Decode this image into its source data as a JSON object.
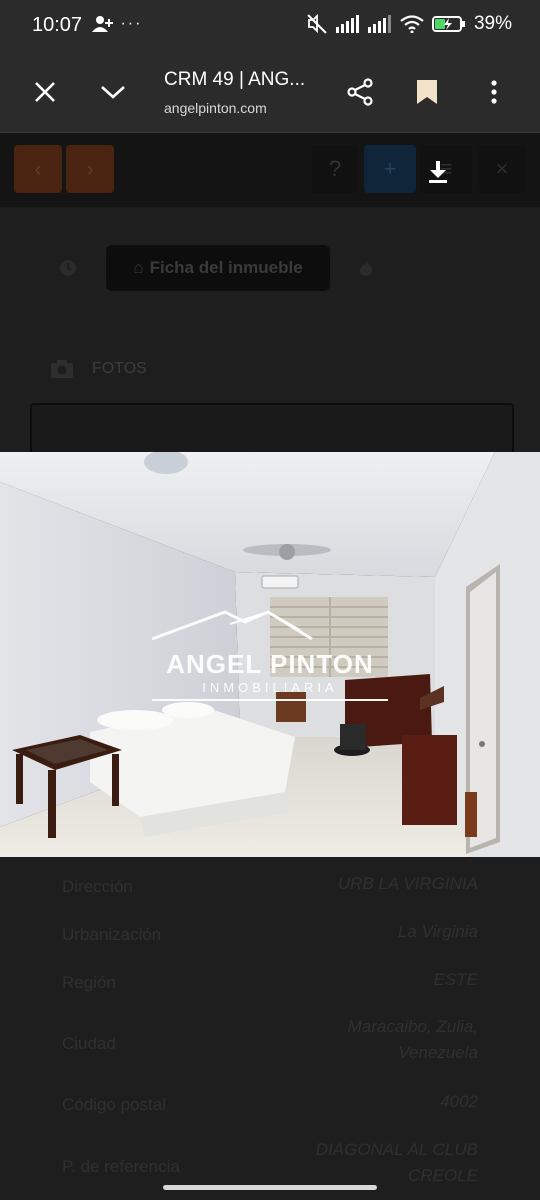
{
  "status_bar": {
    "time": "10:07",
    "left_icons": [
      "person-add-icon",
      "more-dots-icon"
    ],
    "right_icons": [
      "mute-icon",
      "signal-icon",
      "signal-icon",
      "wifi-icon",
      "battery-charging-icon"
    ],
    "battery_percent": "39%"
  },
  "browser": {
    "title": "CRM 49 | ANG...",
    "url": "angelpinton.com"
  },
  "toolbar": {
    "prev_icon": "‹",
    "next_icon": "›",
    "help_icon": "?",
    "add_icon": "+",
    "list_icon": "≡",
    "close_icon": "×"
  },
  "tabs": {
    "ficha_label": "Ficha del inmueble"
  },
  "fotos": {
    "label": "FOTOS"
  },
  "photo": {
    "watermark_main": "ANGEL PINTON",
    "watermark_sub": "INMOBILIARIA"
  },
  "details": [
    {
      "label": "Dirección",
      "value": "URB LA VIRGINIA"
    },
    {
      "label": "Urbanización",
      "value": "La Virginia"
    },
    {
      "label": "Región",
      "value": "ESTE"
    },
    {
      "label": "Ciudad",
      "value": "Maracaibo, Zulia, Venezuela"
    },
    {
      "label": "Código postal",
      "value": "4002"
    },
    {
      "label": "P. de referencia",
      "value": "DIAGONAL AL CLUB CREOLE"
    }
  ]
}
